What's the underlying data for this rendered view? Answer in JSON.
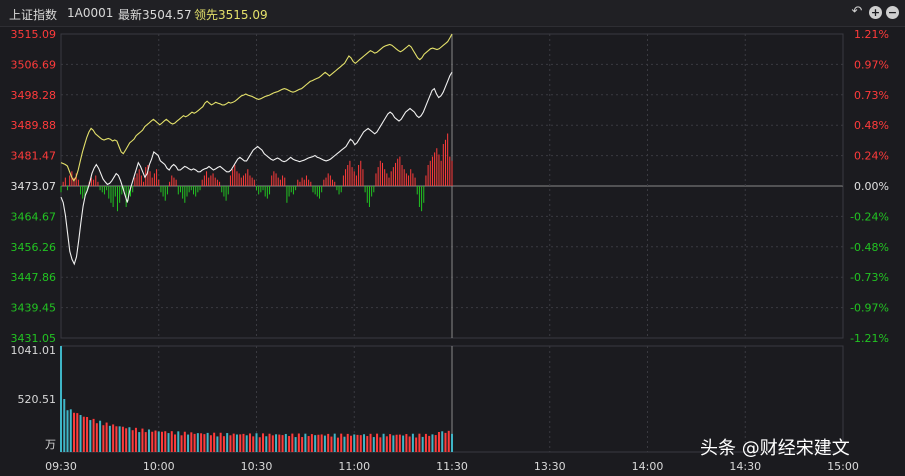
{
  "header": {
    "name": "上证指数",
    "code": "1A0001",
    "latest_label": "最新3504.57",
    "leading_label": "领先3515.09"
  },
  "toolbar": {
    "back_icon": "undo-icon",
    "zoom_in_icon": "plus-circle-icon",
    "zoom_out_icon": "minus-circle-icon",
    "zoom_in_glyph": "+",
    "zoom_out_glyph": "−",
    "back_glyph": "↶"
  },
  "watermark": "头条 @财经宋建文",
  "colors": {
    "up": "#ff3b3b",
    "down": "#22c322",
    "flat": "#e0e0e0",
    "price_line": "#f0f0f0",
    "leading_line": "#e3e06a",
    "volume_cyan": "#3fb6c7",
    "grid": "#3a3a40"
  },
  "chart_data": {
    "type": "line",
    "prev_close": 3473.07,
    "ylim": [
      3431.05,
      3515.09
    ],
    "price_ticks": [
      "3515.09",
      "3506.69",
      "3498.28",
      "3489.88",
      "3481.47",
      "3473.07",
      "3464.67",
      "3456.26",
      "3447.86",
      "3439.45",
      "3431.05"
    ],
    "pct_ticks": [
      "1.21%",
      "0.97%",
      "0.73%",
      "0.48%",
      "0.24%",
      "0.00%",
      "-0.24%",
      "-0.48%",
      "-0.73%",
      "-0.97%",
      "-1.21%"
    ],
    "time_ticks": [
      "09:30",
      "10:00",
      "10:30",
      "11:00",
      "11:30",
      "13:30",
      "14:00",
      "14:30",
      "15:00"
    ],
    "volume_ticks": [
      "1041.01",
      "520.51",
      "万"
    ],
    "volume_max": 1041.01,
    "series": [
      {
        "key": "price",
        "values": [
          3470.0,
          3468.5,
          3465.0,
          3460.0,
          3455.0,
          3452.8,
          3451.5,
          3453.5,
          3458.0,
          3463.0,
          3467.5,
          3470.5,
          3472.0,
          3474.0,
          3476.5,
          3478.0,
          3479.0,
          3478.0,
          3476.5,
          3475.0,
          3474.2,
          3473.5,
          3473.8,
          3474.5,
          3475.5,
          3476.5,
          3476.0,
          3474.5,
          3472.5,
          3470.5,
          3468.5,
          3471.5,
          3473.5,
          3475.5,
          3477.5,
          3479.5,
          3478.5,
          3477.0,
          3475.5,
          3476.5,
          3479.0,
          3480.5,
          3482.5,
          3482.0,
          3481.5,
          3480.0,
          3479.5,
          3479.0,
          3478.0,
          3477.5,
          3478.5,
          3479.0,
          3478.5,
          3477.5,
          3477.5,
          3478.0,
          3478.5,
          3478.2,
          3477.8,
          3477.5,
          3477.8,
          3477.5,
          3477.0,
          3477.0,
          3477.5,
          3477.8,
          3478.0,
          3478.5,
          3478.0,
          3477.5,
          3477.8,
          3478.2,
          3478.5,
          3478.0,
          3477.5,
          3477.0,
          3477.0,
          3477.5,
          3478.5,
          3479.5,
          3480.5,
          3481.0,
          3480.5,
          3480.0,
          3480.0,
          3481.0,
          3482.0,
          3483.0,
          3483.5,
          3484.0,
          3483.5,
          3483.0,
          3482.0,
          3481.5,
          3481.0,
          3480.5,
          3480.2,
          3480.5,
          3480.8,
          3480.5,
          3480.0,
          3479.8,
          3480.0,
          3480.5,
          3481.0,
          3480.5,
          3480.2,
          3480.0,
          3479.8,
          3480.0,
          3480.2,
          3480.5,
          3480.8,
          3481.0,
          3481.2,
          3481.5,
          3481.0,
          3480.8,
          3480.5,
          3480.2,
          3480.0,
          3480.2,
          3480.5,
          3481.0,
          3481.5,
          3482.0,
          3482.5,
          3483.0,
          3483.5,
          3484.0,
          3485.0,
          3486.0,
          3485.5,
          3484.5,
          3485.0,
          3486.0,
          3487.0,
          3488.0,
          3488.5,
          3489.0,
          3488.5,
          3488.0,
          3487.5,
          3488.0,
          3489.0,
          3490.0,
          3491.0,
          3492.0,
          3493.0,
          3493.5,
          3493.0,
          3492.0,
          3491.5,
          3491.0,
          3491.5,
          3492.5,
          3493.5,
          3494.0,
          3494.5,
          3494.0,
          3493.5,
          3492.5,
          3492.0,
          3492.5,
          3493.5,
          3495.0,
          3496.5,
          3498.0,
          3499.5,
          3500.0,
          3498.5,
          3497.5,
          3498.0,
          3499.0,
          3500.5,
          3502.0,
          3503.5,
          3504.57
        ]
      },
      {
        "key": "leading",
        "values": [
          3479.5,
          3479.3,
          3479.0,
          3478.6,
          3477.0,
          3475.5,
          3474.5,
          3475.5,
          3477.5,
          3480.0,
          3482.5,
          3484.5,
          3486.5,
          3488.0,
          3489.0,
          3488.5,
          3487.5,
          3487.0,
          3486.5,
          3486.0,
          3485.8,
          3486.0,
          3486.2,
          3486.0,
          3485.5,
          3485.8,
          3485.5,
          3484.0,
          3482.5,
          3482.0,
          3483.0,
          3484.0,
          3485.0,
          3485.5,
          3486.0,
          3487.0,
          3487.5,
          3488.0,
          3488.5,
          3489.5,
          3490.0,
          3490.5,
          3491.0,
          3491.5,
          3491.0,
          3490.5,
          3490.0,
          3490.5,
          3491.0,
          3491.5,
          3491.0,
          3490.5,
          3490.2,
          3490.5,
          3491.0,
          3491.5,
          3492.0,
          3492.5,
          3492.2,
          3492.5,
          3493.0,
          3493.5,
          3493.2,
          3493.5,
          3494.0,
          3494.5,
          3495.0,
          3496.0,
          3496.5,
          3496.0,
          3495.5,
          3495.8,
          3496.2,
          3496.0,
          3495.8,
          3495.5,
          3495.5,
          3495.8,
          3496.2,
          3496.0,
          3496.2,
          3496.5,
          3497.0,
          3497.5,
          3498.0,
          3498.2,
          3498.5,
          3498.2,
          3498.0,
          3497.8,
          3497.5,
          3497.2,
          3497.0,
          3497.2,
          3497.5,
          3497.8,
          3498.0,
          3498.2,
          3498.5,
          3498.8,
          3499.0,
          3499.2,
          3499.5,
          3499.8,
          3500.0,
          3499.8,
          3499.5,
          3499.2,
          3499.0,
          3499.2,
          3499.5,
          3499.8,
          3500.0,
          3500.5,
          3501.0,
          3501.5,
          3502.0,
          3502.2,
          3502.5,
          3502.8,
          3503.0,
          3503.5,
          3504.0,
          3504.5,
          3504.0,
          3503.5,
          3504.0,
          3504.5,
          3505.0,
          3505.5,
          3506.0,
          3506.5,
          3507.0,
          3508.0,
          3509.0,
          3508.5,
          3507.5,
          3507.0,
          3507.5,
          3508.0,
          3508.5,
          3509.0,
          3509.5,
          3510.0,
          3510.5,
          3510.2,
          3509.8,
          3510.0,
          3510.5,
          3511.0,
          3511.5,
          3511.8,
          3512.0,
          3512.2,
          3512.0,
          3511.5,
          3511.0,
          3510.5,
          3510.2,
          3510.5,
          3511.0,
          3511.5,
          3512.0,
          3511.5,
          3510.5,
          3509.5,
          3508.5,
          3508.0,
          3508.5,
          3509.5,
          3510.0,
          3510.5,
          3511.0,
          3511.2,
          3511.0,
          3510.8,
          3511.0,
          3511.5,
          3512.0,
          3512.5,
          3513.0,
          3514.0,
          3515.09
        ]
      }
    ],
    "buy_sell_bars": [
      -3,
      2,
      4,
      -2,
      5,
      7,
      4,
      6,
      3,
      -4,
      -6,
      -5,
      -3,
      2,
      4,
      3,
      5,
      2,
      -2,
      -3,
      -4,
      -2,
      -6,
      -8,
      -10,
      -5,
      -12,
      -8,
      -4,
      -3,
      -10,
      -7,
      -5,
      -3,
      4,
      6,
      8,
      5,
      2,
      9,
      10,
      7,
      4,
      6,
      8,
      3,
      -3,
      -5,
      -7,
      -4,
      2,
      5,
      4,
      3,
      -4,
      -3,
      -6,
      -8,
      -5,
      -3,
      -2,
      -4,
      -5,
      -3,
      -2,
      3,
      5,
      7,
      4,
      5,
      6,
      4,
      3,
      2,
      -3,
      -5,
      -7,
      -4,
      5,
      8,
      10,
      7,
      6,
      4,
      5,
      6,
      8,
      5,
      4,
      3,
      -2,
      -4,
      -3,
      -2,
      -5,
      -6,
      -4,
      5,
      7,
      6,
      4,
      3,
      5,
      4,
      -8,
      -5,
      -3,
      -4,
      -2,
      3,
      2,
      4,
      3,
      5,
      3,
      2,
      -3,
      -4,
      -5,
      -6,
      -3,
      3,
      4,
      6,
      5,
      3,
      2,
      -2,
      -4,
      -3,
      5,
      8,
      10,
      12,
      9,
      7,
      5,
      10,
      12,
      8,
      -3,
      -8,
      -10,
      -5,
      -3,
      6,
      9,
      12,
      11,
      8,
      6,
      4,
      7,
      9,
      11,
      13,
      14,
      10,
      8,
      6,
      5,
      8,
      6,
      4,
      -4,
      -10,
      -12,
      -8,
      5,
      10,
      12,
      14,
      16,
      18,
      15,
      12,
      20,
      22,
      25,
      14,
      12
    ]
  }
}
